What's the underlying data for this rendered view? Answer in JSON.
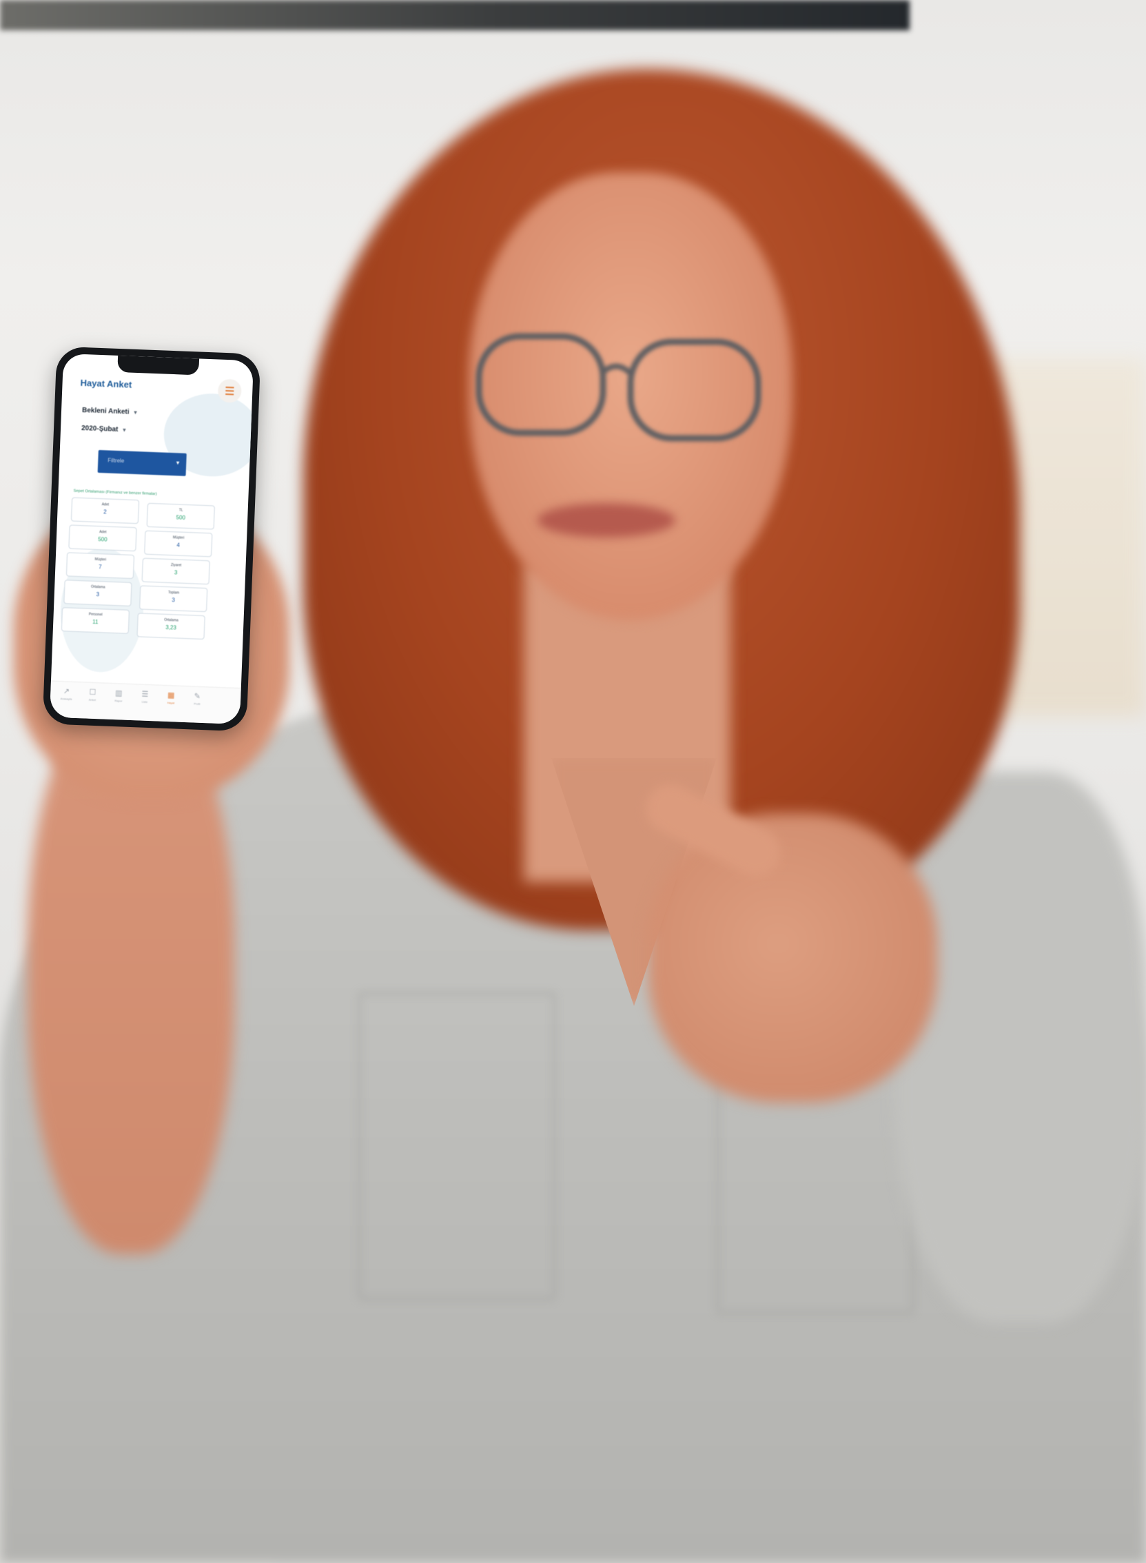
{
  "app": {
    "title": "Hayat Anket",
    "survey_selector": "Bekleni Anketi",
    "period_selector": "2020-Şubat",
    "filter_select_label": "Filtrele"
  },
  "colors": {
    "brand_blue": "#1e56a0",
    "accent_orange": "#e07d3a",
    "value_green": "#23a06c"
  },
  "icons": {
    "menu": "hamburger-menu-icon",
    "chevron": "chevron-down-icon"
  },
  "results": {
    "section_title": "Sepet Ortalaması (Firmanız ve benzer firmalar)",
    "cards": [
      {
        "label": "Adet",
        "value": "2",
        "green": false
      },
      {
        "label": "TL",
        "value": "500",
        "green": true
      },
      {
        "label": "Adet",
        "value": "500",
        "green": true
      },
      {
        "label": "Müşteri",
        "value": "4",
        "green": false
      },
      {
        "label": "Müşteri",
        "value": "7",
        "green": false
      },
      {
        "label": "Ziyaret",
        "value": "3",
        "green": true
      },
      {
        "label": "Ortalama",
        "value": "3",
        "green": false
      },
      {
        "label": "Toplam",
        "value": "3",
        "green": false
      },
      {
        "label": "Personel",
        "value": "11",
        "green": true
      },
      {
        "label": "Ortalama",
        "value": "3,23",
        "green": true
      }
    ]
  },
  "tabbar": {
    "tabs": [
      {
        "icon": "↗",
        "label": "Anasayfa",
        "active": false
      },
      {
        "icon": "☐",
        "label": "Anket",
        "active": false
      },
      {
        "icon": "▥",
        "label": "Rapor",
        "active": false
      },
      {
        "icon": "☰",
        "label": "Liste",
        "active": false
      },
      {
        "icon": "▦",
        "label": "Hayat",
        "active": true
      },
      {
        "icon": "✎",
        "label": "Profil",
        "active": false
      }
    ]
  }
}
